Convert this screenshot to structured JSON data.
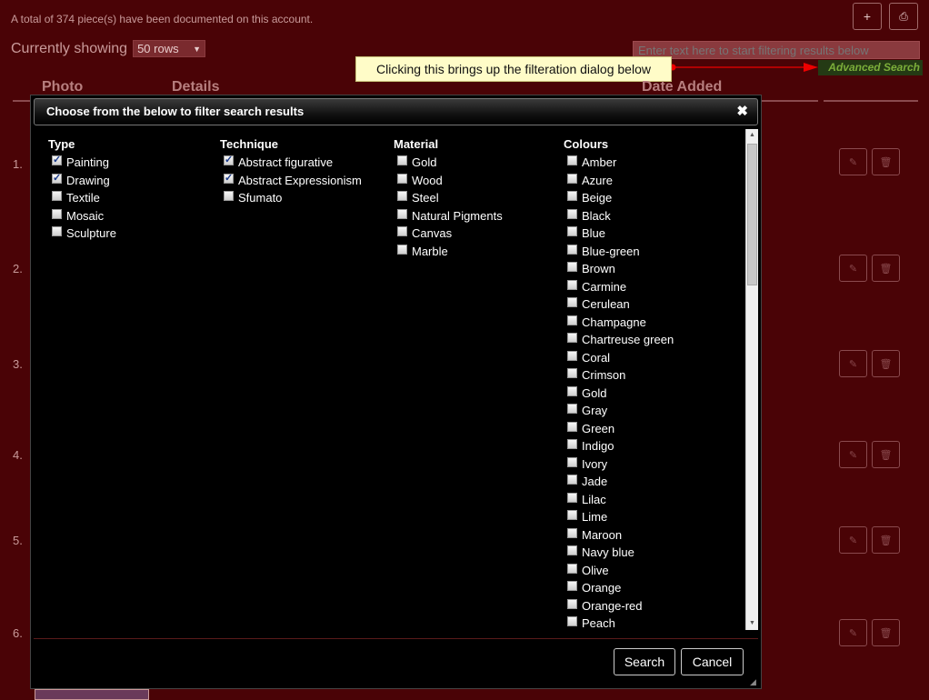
{
  "summary_text": "A total of 374 piece(s) have been documented on this account.",
  "showing": {
    "label": "Currently showing",
    "rows_value": "50 rows"
  },
  "top_buttons": {
    "add": "+",
    "print": "⎙"
  },
  "filter": {
    "placeholder": "Enter text here to start filtering results below"
  },
  "advanced_search": "Advanced Search",
  "tooltip": "Clicking this brings up the filteration dialog below",
  "columns": {
    "photo": "Photo",
    "details": "Details",
    "date_added": "Date Added"
  },
  "rows": [
    "1.",
    "2.",
    "3.",
    "4.",
    "5.",
    "6."
  ],
  "row_icons": {
    "edit": "✎",
    "delete": "🗑"
  },
  "dialog": {
    "title": "Choose from the below to filter search results",
    "close": "✖",
    "groups": [
      {
        "title": "Type",
        "options": [
          {
            "label": "Painting",
            "checked": true
          },
          {
            "label": "Drawing",
            "checked": true
          },
          {
            "label": "Textile",
            "checked": false
          },
          {
            "label": "Mosaic",
            "checked": false
          },
          {
            "label": "Sculpture",
            "checked": false
          }
        ]
      },
      {
        "title": "Technique",
        "options": [
          {
            "label": "Abstract figurative",
            "checked": true
          },
          {
            "label": "Abstract Expressionism",
            "checked": true
          },
          {
            "label": "Sfumato",
            "checked": false
          }
        ]
      },
      {
        "title": "Material",
        "options": [
          {
            "label": "Gold",
            "checked": false
          },
          {
            "label": "Wood",
            "checked": false
          },
          {
            "label": "Steel",
            "checked": false
          },
          {
            "label": "Natural Pigments",
            "checked": false
          },
          {
            "label": "Canvas",
            "checked": false
          },
          {
            "label": "Marble",
            "checked": false
          }
        ]
      },
      {
        "title": "Colours",
        "options": [
          {
            "label": "Amber",
            "checked": false
          },
          {
            "label": "Azure",
            "checked": false
          },
          {
            "label": "Beige",
            "checked": false
          },
          {
            "label": "Black",
            "checked": false
          },
          {
            "label": "Blue",
            "checked": false
          },
          {
            "label": "Blue-green",
            "checked": false
          },
          {
            "label": "Brown",
            "checked": false
          },
          {
            "label": "Carmine",
            "checked": false
          },
          {
            "label": "Cerulean",
            "checked": false
          },
          {
            "label": "Champagne",
            "checked": false
          },
          {
            "label": "Chartreuse green",
            "checked": false
          },
          {
            "label": "Coral",
            "checked": false
          },
          {
            "label": "Crimson",
            "checked": false
          },
          {
            "label": "Gold",
            "checked": false
          },
          {
            "label": "Gray",
            "checked": false
          },
          {
            "label": "Green",
            "checked": false
          },
          {
            "label": "Indigo",
            "checked": false
          },
          {
            "label": "Ivory",
            "checked": false
          },
          {
            "label": "Jade",
            "checked": false
          },
          {
            "label": "Lilac",
            "checked": false
          },
          {
            "label": "Lime",
            "checked": false
          },
          {
            "label": "Maroon",
            "checked": false
          },
          {
            "label": "Navy blue",
            "checked": false
          },
          {
            "label": "Olive",
            "checked": false
          },
          {
            "label": "Orange",
            "checked": false
          },
          {
            "label": "Orange-red",
            "checked": false
          },
          {
            "label": "Peach",
            "checked": false
          }
        ]
      }
    ],
    "search_button": "Search",
    "cancel_button": "Cancel"
  }
}
